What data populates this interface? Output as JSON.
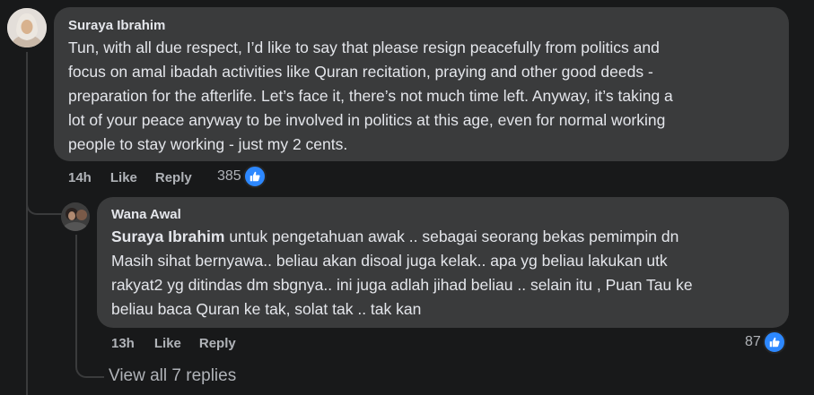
{
  "comments": {
    "main": {
      "author": "Suraya Ibrahim",
      "lines": [
        "Tun, with all due respect, I’d like to say that please resign peacefully from politics and",
        "focus on amal ibadah activities like Quran recitation, praying and other good deeds -",
        "preparation for the afterlife. Let’s face it, there’s not much time left. Anyway, it’s taking a",
        "lot of your peace anyway to be involved in politics at this age, even for normal working",
        "people to stay working - just my 2 cents."
      ],
      "time": "14h",
      "like_label": "Like",
      "reply_label": "Reply",
      "reaction_count": "385"
    },
    "reply": {
      "author": "Wana Awal",
      "mention": "Suraya Ibrahim",
      "first_line_rest": " untuk pengetahuan awak .. sebagai seorang bekas pemimpin dn",
      "lines": [
        "Masih sihat bernyawa.. beliau akan disoal juga kelak.. apa yg beliau lakukan utk",
        "rakyat2 yg ditindas dm sbgnya.. ini juga adlah jihad beliau .. selain itu , Puan Tau ke",
        "beliau baca Quran ke tak, solat tak .. tak kan"
      ],
      "time": "13h",
      "like_label": "Like",
      "reply_label": "Reply",
      "reaction_count": "87"
    }
  },
  "view_all_label": "View all 7 replies",
  "icons": {
    "reaction": "thumbs-up-icon"
  },
  "colors": {
    "background": "#18191a",
    "bubble": "#3a3b3c",
    "like_blue": "#2d88ff",
    "muted": "#b0b3b8"
  }
}
